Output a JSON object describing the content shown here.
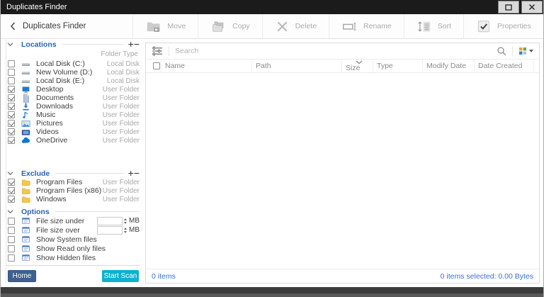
{
  "window": {
    "title": "Duplicates Finder"
  },
  "toolbar": {
    "back_label": "Duplicates Finder",
    "buttons": [
      {
        "label": "Move",
        "icon": "move-folder-icon"
      },
      {
        "label": "Copy",
        "icon": "copy-icon"
      },
      {
        "label": "Delete",
        "icon": "delete-x-icon"
      },
      {
        "label": "Rename",
        "icon": "rename-icon"
      },
      {
        "label": "Sort",
        "icon": "sort-icon"
      },
      {
        "label": "Properties",
        "icon": "properties-check-icon"
      }
    ]
  },
  "sidebar": {
    "locations": {
      "title": "Locations",
      "column_header": "Folder Type",
      "items": [
        {
          "label": "Local Disk (C:)",
          "type": "Local Disk",
          "checked": false,
          "icon": "drive-icon"
        },
        {
          "label": "New Volume (D:)",
          "type": "Local Disk",
          "checked": false,
          "icon": "drive-icon"
        },
        {
          "label": "Local Disk (E:)",
          "type": "Local Disk",
          "checked": false,
          "icon": "drive-icon"
        },
        {
          "label": "Desktop",
          "type": "User Folder",
          "checked": true,
          "icon": "desktop-icon"
        },
        {
          "label": "Documents",
          "type": "User Folder",
          "checked": true,
          "icon": "documents-icon"
        },
        {
          "label": "Downloads",
          "type": "User Folder",
          "checked": true,
          "icon": "downloads-icon"
        },
        {
          "label": "Music",
          "type": "User Folder",
          "checked": true,
          "icon": "music-icon"
        },
        {
          "label": "Pictures",
          "type": "User Folder",
          "checked": true,
          "icon": "pictures-icon"
        },
        {
          "label": "Videos",
          "type": "User Folder",
          "checked": true,
          "icon": "videos-icon"
        },
        {
          "label": "OneDrive",
          "type": "User Folder",
          "checked": true,
          "icon": "onedrive-cloud-icon"
        }
      ]
    },
    "exclude": {
      "title": "Exclude",
      "items": [
        {
          "label": "Program Files",
          "type": "User Folder",
          "checked": true,
          "icon": "folder-icon"
        },
        {
          "label": "Program Files (x86)",
          "type": "User Folder",
          "checked": true,
          "icon": "folder-icon"
        },
        {
          "label": "Windows",
          "type": "User Folder",
          "checked": true,
          "icon": "folder-icon"
        }
      ]
    },
    "options": {
      "title": "Options",
      "items": [
        {
          "label": "File size under",
          "checked": false,
          "value": "",
          "unit": "MB",
          "icon": "option-list-icon"
        },
        {
          "label": "File size over",
          "checked": false,
          "value": "",
          "unit": "MB",
          "icon": "option-list-icon"
        },
        {
          "label": "Show System files",
          "checked": false,
          "icon": "option-list-icon"
        },
        {
          "label": "Show Read only files",
          "checked": false,
          "icon": "option-list-icon"
        },
        {
          "label": "Show Hidden files",
          "checked": false,
          "icon": "option-list-icon"
        }
      ]
    },
    "home_button": "Home",
    "start_scan_button": "Start Scan"
  },
  "main": {
    "search": {
      "placeholder": "Search"
    },
    "table": {
      "columns": [
        "Name",
        "Path",
        "Size",
        "Type",
        "Modify Date",
        "Date Created"
      ],
      "sorted_column": "Size",
      "rows": []
    },
    "status": {
      "left": "0 items",
      "right": "0 items selected: 0.00 Bytes"
    }
  },
  "colors": {
    "titlebar": "#1b1b1b",
    "section_header_blue": "#2b62b8",
    "status_blue": "#3a6fd8",
    "home_button": "#3c6191",
    "start_scan_button": "#0cb2d0",
    "disabled_gray": "#ababab"
  }
}
